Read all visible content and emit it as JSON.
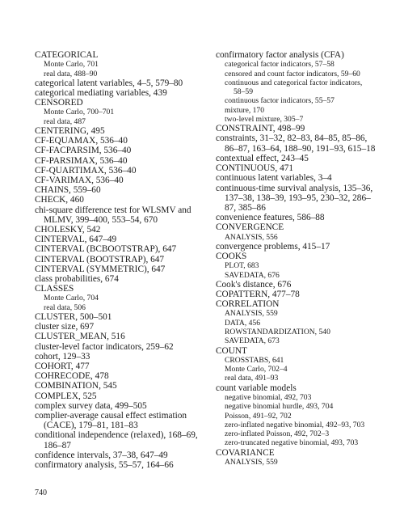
{
  "page": {
    "folio": "740"
  },
  "left_column": [
    {
      "level": 1,
      "lines": [
        "CATEGORICAL"
      ]
    },
    {
      "level": 2,
      "lines": [
        "Monte Carlo, 701"
      ]
    },
    {
      "level": 2,
      "lines": [
        "real data, 488–90"
      ]
    },
    {
      "level": 1,
      "lines": [
        "categorical latent variables, 4–5, 579–80"
      ]
    },
    {
      "level": 1,
      "lines": [
        "categorical mediating variables, 439"
      ]
    },
    {
      "level": 1,
      "lines": [
        "CENSORED"
      ]
    },
    {
      "level": 2,
      "lines": [
        "Monte Carlo, 700–701"
      ]
    },
    {
      "level": 2,
      "lines": [
        "real data, 487"
      ]
    },
    {
      "level": 1,
      "lines": [
        "CENTERING, 495"
      ]
    },
    {
      "level": 1,
      "lines": [
        "CF-EQUAMAX, 536–40"
      ]
    },
    {
      "level": 1,
      "lines": [
        "CF-FACPARSIM, 536–40"
      ]
    },
    {
      "level": 1,
      "lines": [
        "CF-PARSIMAX, 536–40"
      ]
    },
    {
      "level": 1,
      "lines": [
        "CF-QUARTIMAX, 536–40"
      ]
    },
    {
      "level": 1,
      "lines": [
        "CF-VARIMAX, 536–40"
      ]
    },
    {
      "level": 1,
      "lines": [
        "CHAINS, 559–60"
      ]
    },
    {
      "level": 1,
      "lines": [
        "CHECK, 460"
      ]
    },
    {
      "level": 1,
      "lines": [
        "chi-square difference test for WLSMV and",
        "MLMV, 399–400, 553–54, 670"
      ]
    },
    {
      "level": 1,
      "lines": [
        "CHOLESKY, 542"
      ]
    },
    {
      "level": 1,
      "lines": [
        "CINTERVAL, 647–49"
      ]
    },
    {
      "level": 1,
      "lines": [
        "CINTERVAL (BCBOOTSTRAP), 647"
      ]
    },
    {
      "level": 1,
      "lines": [
        "CINTERVAL (BOOTSTRAP), 647"
      ]
    },
    {
      "level": 1,
      "lines": [
        "CINTERVAL (SYMMETRIC), 647"
      ]
    },
    {
      "level": 1,
      "lines": [
        "class probabilities, 674"
      ]
    },
    {
      "level": 1,
      "lines": [
        "CLASSES"
      ]
    },
    {
      "level": 2,
      "lines": [
        "Monte Carlo, 704"
      ]
    },
    {
      "level": 2,
      "lines": [
        "real data, 506"
      ]
    },
    {
      "level": 1,
      "lines": [
        "CLUSTER, 500–501"
      ]
    },
    {
      "level": 1,
      "lines": [
        "cluster size, 697"
      ]
    },
    {
      "level": 1,
      "lines": [
        "CLUSTER_MEAN, 516"
      ]
    },
    {
      "level": 1,
      "lines": [
        "cluster-level factor indicators, 259–62"
      ]
    },
    {
      "level": 1,
      "lines": [
        "cohort, 129–33"
      ]
    },
    {
      "level": 1,
      "lines": [
        "COHORT, 477"
      ]
    },
    {
      "level": 1,
      "lines": [
        "COHRECODE, 478"
      ]
    },
    {
      "level": 1,
      "lines": [
        "COMBINATION, 545"
      ]
    },
    {
      "level": 1,
      "lines": [
        "COMPLEX, 525"
      ]
    },
    {
      "level": 1,
      "lines": [
        "complex survey data, 499–505"
      ]
    },
    {
      "level": 1,
      "lines": [
        "complier-average causal effect estimation",
        "(CACE), 179–81, 181–83"
      ]
    },
    {
      "level": 1,
      "lines": [
        "conditional independence (relaxed), 168–69,",
        "186–87"
      ]
    },
    {
      "level": 1,
      "lines": [
        "confidence intervals, 37–38, 647–49"
      ]
    },
    {
      "level": 1,
      "lines": [
        "confirmatory analysis, 55–57, 164–66"
      ]
    }
  ],
  "right_column": [
    {
      "level": 1,
      "lines": [
        "confirmatory factor analysis (CFA)"
      ]
    },
    {
      "level": 2,
      "lines": [
        "categorical factor indicators, 57–58"
      ]
    },
    {
      "level": 2,
      "lines": [
        "censored and count factor indicators, 59–60"
      ]
    },
    {
      "level": 2,
      "lines": [
        "continuous and categorical factor indicators,",
        "58–59"
      ]
    },
    {
      "level": 2,
      "lines": [
        "continuous factor indicators, 55–57"
      ]
    },
    {
      "level": 2,
      "lines": [
        "mixture, 170"
      ]
    },
    {
      "level": 2,
      "lines": [
        "two-level mixture, 305–7"
      ]
    },
    {
      "level": 1,
      "lines": [
        "CONSTRAINT, 498–99"
      ]
    },
    {
      "level": 1,
      "lines": [
        "constraints, 31–32, 82–83, 84–85, 85–86,",
        "86–87, 163–64, 188–90, 191–93, 615–18"
      ]
    },
    {
      "level": 1,
      "lines": [
        "contextual effect, 243–45"
      ]
    },
    {
      "level": 1,
      "lines": [
        "CONTINUOUS, 471"
      ]
    },
    {
      "level": 1,
      "lines": [
        "continuous latent variables, 3–4"
      ]
    },
    {
      "level": 1,
      "lines": [
        "continuous-time survival analysis, 135–36,",
        "137–38, 138–39, 193–95, 230–32, 286–",
        "87, 385–86"
      ]
    },
    {
      "level": 1,
      "lines": [
        "convenience features, 586–88"
      ]
    },
    {
      "level": 1,
      "lines": [
        "CONVERGENCE"
      ]
    },
    {
      "level": 2,
      "lines": [
        "ANALYSIS, 556"
      ]
    },
    {
      "level": 1,
      "lines": [
        "convergence problems, 415–17"
      ]
    },
    {
      "level": 1,
      "lines": [
        "COOKS"
      ]
    },
    {
      "level": 2,
      "lines": [
        "PLOT, 683"
      ]
    },
    {
      "level": 2,
      "lines": [
        "SAVEDATA, 676"
      ]
    },
    {
      "level": 1,
      "lines": [
        "Cook's distance, 676"
      ]
    },
    {
      "level": 1,
      "lines": [
        "COPATTERN, 477–78"
      ]
    },
    {
      "level": 1,
      "lines": [
        "CORRELATION"
      ]
    },
    {
      "level": 2,
      "lines": [
        "ANALYSIS, 559"
      ]
    },
    {
      "level": 2,
      "lines": [
        "DATA, 456"
      ]
    },
    {
      "level": 2,
      "lines": [
        "ROWSTANDARDIZATION, 540"
      ]
    },
    {
      "level": 2,
      "lines": [
        "SAVEDATA, 673"
      ]
    },
    {
      "level": 1,
      "lines": [
        "COUNT"
      ]
    },
    {
      "level": 2,
      "lines": [
        "CROSSTABS, 641"
      ]
    },
    {
      "level": 2,
      "lines": [
        "Monte Carlo, 702–4"
      ]
    },
    {
      "level": 2,
      "lines": [
        "real data, 491–93"
      ]
    },
    {
      "level": 1,
      "lines": [
        "count variable models"
      ]
    },
    {
      "level": 2,
      "lines": [
        "negative binomial, 492, 703"
      ]
    },
    {
      "level": 2,
      "lines": [
        "negative binomial hurdle, 493, 704"
      ]
    },
    {
      "level": 2,
      "lines": [
        "Poisson, 491–92, 702"
      ]
    },
    {
      "level": 2,
      "lines": [
        "zero-inflated negative binomial, 492–93, 703"
      ]
    },
    {
      "level": 2,
      "lines": [
        "zero-inflated Poisson, 492, 702–3"
      ]
    },
    {
      "level": 2,
      "lines": [
        "zero-truncated negative binomial, 493, 703"
      ]
    },
    {
      "level": 1,
      "lines": [
        "COVARIANCE"
      ]
    },
    {
      "level": 2,
      "lines": [
        "ANALYSIS, 559"
      ]
    }
  ]
}
